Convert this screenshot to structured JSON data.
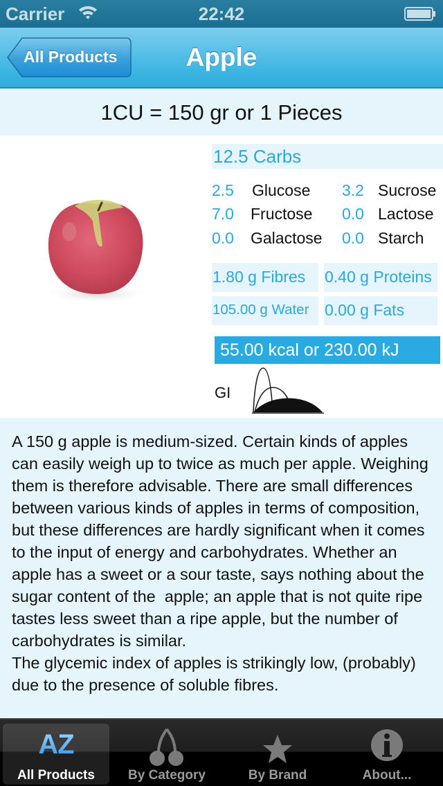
{
  "status_bar": {
    "carrier": "Carrier",
    "time": "22:42"
  },
  "nav": {
    "back_label": "All Products",
    "title": "Apple"
  },
  "serving": {
    "text": "1CU = 150 gr or   1 Pieces"
  },
  "product": {
    "image_alt": "Red apple photo"
  },
  "carbs": {
    "header": "12.5 Carbs",
    "sugars": [
      {
        "value": "2.5",
        "name": "Glucose"
      },
      {
        "value": "3.2",
        "name": "Sucrose"
      },
      {
        "value": "7.0",
        "name": "Fructose"
      },
      {
        "value": "0.0",
        "name": "Lactose"
      },
      {
        "value": "0.0",
        "name": "Galactose"
      },
      {
        "value": "0.0",
        "name": "Starch"
      }
    ]
  },
  "nutrients": {
    "fibres": "1.80 g Fibres",
    "proteins": "0.40 g Proteins",
    "water": "105.00 g Water",
    "fats": "0.00 g Fats"
  },
  "energy": {
    "text": "55.00 kcal or 230.00 kJ"
  },
  "gi": {
    "label": "GI",
    "icon": "gi-low-curve-icon"
  },
  "description": {
    "text": "A 150 g apple is medium-sized. Certain kinds of apples can easily weigh up to twice as much per apple. Weighing them is therefore advisable. There are small differences between various kinds of apples in terms of composition, but these differences are hardly significant when it comes to the input of energy and carbohydrates. Whether an apple has a sweet or a sour taste, says nothing about the sugar content of the  apple; an apple that is not quite ripe tastes less sweet than a ripe apple, but the number of carbohydrates is similar.\nThe glycemic index of apples is strikingly low, (probably) due to the presence of soluble fibres."
  },
  "tabbar": {
    "tabs": [
      {
        "label": "All Products",
        "icon": "az-icon",
        "selected": true
      },
      {
        "label": "By Category",
        "icon": "cherries-icon",
        "selected": false
      },
      {
        "label": "By Brand",
        "icon": "star-icon",
        "selected": false
      },
      {
        "label": "About...",
        "icon": "info-icon",
        "selected": false
      }
    ],
    "az_glyph": "AZ"
  },
  "colors": {
    "accent": "#29abe2",
    "panel_bg": "#e5f5fb",
    "nav_top": "#7dcdee",
    "nav_bottom": "#2eaddc",
    "tabbar_bg": "#000000"
  }
}
